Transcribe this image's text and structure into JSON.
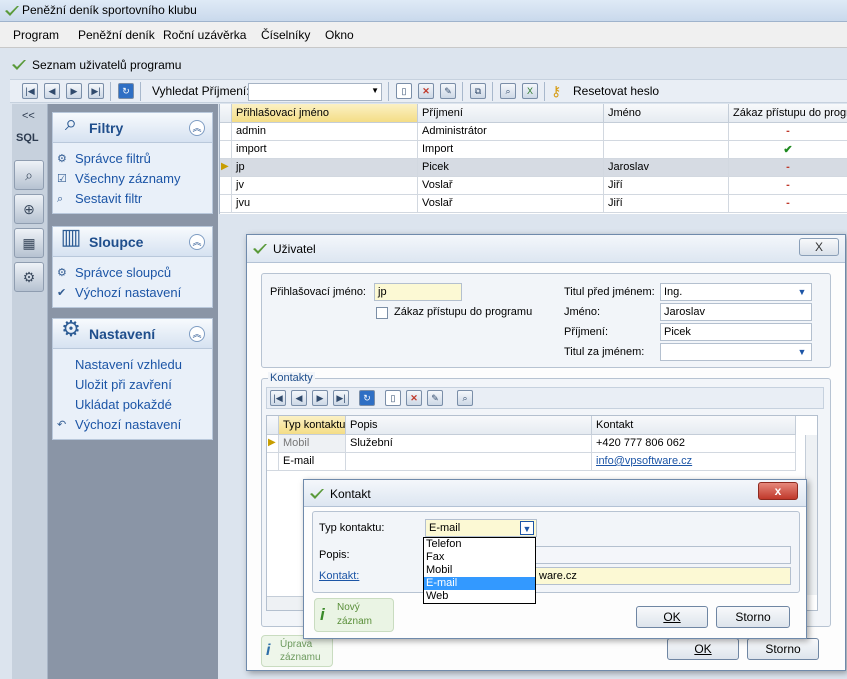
{
  "window": {
    "title": "Peněžní deník sportovního klubu"
  },
  "menu": [
    "Program",
    "Peněžní deník",
    "Roční uzávěrka",
    "Číselníky",
    "Okno"
  ],
  "subwindow": {
    "title": "Seznam uživatelů programu"
  },
  "toolbar": {
    "search_label": "Vyhledat Příjmení:",
    "search_value": "",
    "reset_label": "Resetovat heslo"
  },
  "leftstrip": {
    "collapse": "<<",
    "sql": "SQL"
  },
  "sidebar": {
    "filters": {
      "title": "Filtry",
      "items": [
        "Správce filtrů",
        "Všechny záznamy",
        "Sestavit filtr"
      ]
    },
    "columns": {
      "title": "Sloupce",
      "items": [
        "Správce sloupců",
        "Výchozí nastavení"
      ]
    },
    "settings": {
      "title": "Nastavení",
      "items": [
        "Nastavení vzhledu",
        "Uložit při zavření",
        "Ukládat pokaždé",
        "Výchozí nastavení"
      ]
    }
  },
  "grid": {
    "headers": [
      "Přihlašovací jméno",
      "Příjmení",
      "Jméno",
      "Zákaz přístupu do progra"
    ],
    "rows": [
      {
        "login": "admin",
        "surname": "Administrátor",
        "name": "",
        "ban": "-"
      },
      {
        "login": "import",
        "surname": "Import",
        "name": "",
        "ban": "✔"
      },
      {
        "login": "jp",
        "surname": "Picek",
        "name": "Jaroslav",
        "ban": "-"
      },
      {
        "login": "jv",
        "surname": "Voslař",
        "name": "Jiří",
        "ban": "-"
      },
      {
        "login": "jvu",
        "surname": "Voslař",
        "name": "Jiří",
        "ban": "-"
      }
    ]
  },
  "user_dialog": {
    "title": "Uživatel",
    "close": "X",
    "login_label": "Přihlašovací jméno:",
    "login_value": "jp",
    "ban_label": "Zákaz přístupu do programu",
    "title_before_label": "Titul před jménem:",
    "title_before_value": "Ing.",
    "first_label": "Jméno:",
    "first_value": "Jaroslav",
    "last_label": "Příjmení:",
    "last_value": "Picek",
    "title_after_label": "Titul za jménem:",
    "title_after_value": "",
    "contacts_label": "Kontakty",
    "contacts_headers": [
      "Typ kontaktu",
      "Popis",
      "Kontakt"
    ],
    "contacts_rows": [
      {
        "type": "Mobil",
        "desc": "Služební",
        "contact": "+420 777 806 062"
      },
      {
        "type": "E-mail",
        "desc": "",
        "contact": "info@vpsoftware.cz"
      }
    ],
    "info_line1": "Úprava",
    "info_line2": "záznamu",
    "ok": "OK",
    "cancel": "Storno"
  },
  "contact_dialog": {
    "title": "Kontakt",
    "close": "x",
    "type_label": "Typ kontaktu:",
    "type_value": "E-mail",
    "desc_label": "Popis:",
    "desc_value": "",
    "contact_label": "Kontakt:",
    "contact_value": "info@vpsoftware.cz",
    "contact_value_visible": "ware.cz",
    "options": [
      "Telefon",
      "Fax",
      "Mobil",
      "E-mail",
      "Web"
    ],
    "selected_option": "E-mail",
    "info_line1": "Nový",
    "info_line2": "záznam",
    "ok": "OK",
    "cancel": "Storno"
  },
  "colors": {
    "accent": "#1f4e8c",
    "selection": "#3399ff",
    "grid_selected": "#d6dbe3",
    "close_red": "#c0392b"
  }
}
